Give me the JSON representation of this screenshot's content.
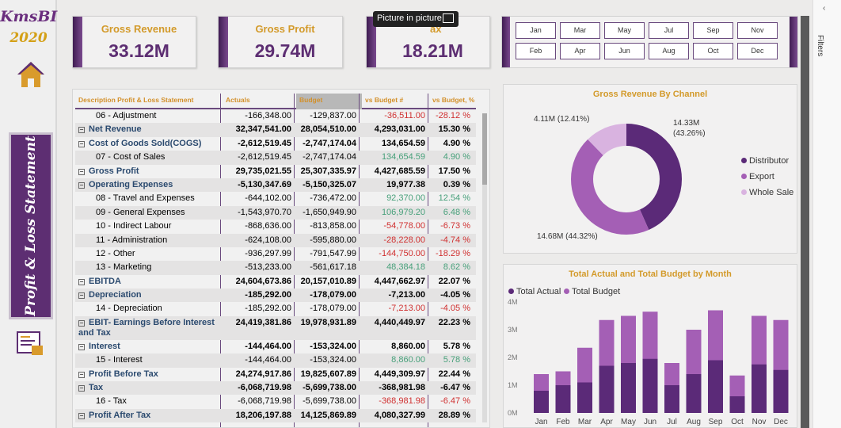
{
  "app": {
    "logo_title": "KmsBI",
    "logo_year": "2020",
    "side_title": "Profit & Loss Statement",
    "pip_label": "Picture in picture",
    "filters_label": "Filters"
  },
  "kpis": [
    {
      "label": "Gross Revenue",
      "value": "33.12M"
    },
    {
      "label": "Gross Profit",
      "value": "29.74M"
    },
    {
      "label": "ax",
      "value": "18.21M"
    }
  ],
  "months": [
    [
      "Jan",
      "Mar",
      "May",
      "Jul",
      "Sep",
      "Nov"
    ],
    [
      "Feb",
      "Apr",
      "Jun",
      "Aug",
      "Oct",
      "Dec"
    ]
  ],
  "table": {
    "headers": [
      "Description Profit & Loss Statement",
      "Actuals",
      "Budget",
      "vs Budget #",
      "vs Budget, %"
    ],
    "rows": [
      {
        "desc": "06 - Adjustment",
        "level": 1,
        "actual": "-166,348.00",
        "budget": "-129,837.00",
        "vb": "-36,511.00",
        "vp": "-28.12 %",
        "tone": "neg"
      },
      {
        "desc": "Net Revenue",
        "level": 0,
        "actual": "32,347,541.00",
        "budget": "28,054,510.00",
        "vb": "4,293,031.00",
        "vp": "15.30 %",
        "tone": ""
      },
      {
        "desc": "Cost of Goods Sold(COGS)",
        "level": 0,
        "actual": "-2,612,519.45",
        "budget": "-2,747,174.04",
        "vb": "134,654.59",
        "vp": "4.90 %",
        "tone": ""
      },
      {
        "desc": "07 - Cost of Sales",
        "level": 1,
        "actual": "-2,612,519.45",
        "budget": "-2,747,174.04",
        "vb": "134,654.59",
        "vp": "4.90 %",
        "tone": "pos"
      },
      {
        "desc": "Gross Profit",
        "level": 0,
        "actual": "29,735,021.55",
        "budget": "25,307,335.97",
        "vb": "4,427,685.59",
        "vp": "17.50 %",
        "tone": ""
      },
      {
        "desc": "Operating Expenses",
        "level": 0,
        "actual": "-5,130,347.69",
        "budget": "-5,150,325.07",
        "vb": "19,977.38",
        "vp": "0.39 %",
        "tone": ""
      },
      {
        "desc": "08 - Travel and Expenses",
        "level": 1,
        "actual": "-644,102.00",
        "budget": "-736,472.00",
        "vb": "92,370.00",
        "vp": "12.54 %",
        "tone": "pos"
      },
      {
        "desc": "09 - General Expenses",
        "level": 1,
        "actual": "-1,543,970.70",
        "budget": "-1,650,949.90",
        "vb": "106,979.20",
        "vp": "6.48 %",
        "tone": "pos"
      },
      {
        "desc": "10 - Indirect Labour",
        "level": 1,
        "actual": "-868,636.00",
        "budget": "-813,858.00",
        "vb": "-54,778.00",
        "vp": "-6.73 %",
        "tone": "neg"
      },
      {
        "desc": "11 - Administration",
        "level": 1,
        "actual": "-624,108.00",
        "budget": "-595,880.00",
        "vb": "-28,228.00",
        "vp": "-4.74 %",
        "tone": "neg"
      },
      {
        "desc": "12 - Other",
        "level": 1,
        "actual": "-936,297.99",
        "budget": "-791,547.99",
        "vb": "-144,750.00",
        "vp": "-18.29 %",
        "tone": "neg"
      },
      {
        "desc": "13 - Marketing",
        "level": 1,
        "actual": "-513,233.00",
        "budget": "-561,617.18",
        "vb": "48,384.18",
        "vp": "8.62 %",
        "tone": "pos"
      },
      {
        "desc": "EBITDA",
        "level": 0,
        "actual": "24,604,673.86",
        "budget": "20,157,010.89",
        "vb": "4,447,662.97",
        "vp": "22.07 %",
        "tone": ""
      },
      {
        "desc": "Depreciation",
        "level": 0,
        "actual": "-185,292.00",
        "budget": "-178,079.00",
        "vb": "-7,213.00",
        "vp": "-4.05 %",
        "tone": ""
      },
      {
        "desc": "14 - Depreciation",
        "level": 1,
        "actual": "-185,292.00",
        "budget": "-178,079.00",
        "vb": "-7,213.00",
        "vp": "-4.05 %",
        "tone": "neg"
      },
      {
        "desc": "EBIT- Earnings Before Interest and Tax",
        "level": 0,
        "tall": true,
        "actual": "24,419,381.86",
        "budget": "19,978,931.89",
        "vb": "4,440,449.97",
        "vp": "22.23 %",
        "tone": ""
      },
      {
        "desc": "Interest",
        "level": 0,
        "actual": "-144,464.00",
        "budget": "-153,324.00",
        "vb": "8,860.00",
        "vp": "5.78 %",
        "tone": ""
      },
      {
        "desc": "15 - Interest",
        "level": 1,
        "actual": "-144,464.00",
        "budget": "-153,324.00",
        "vb": "8,860.00",
        "vp": "5.78 %",
        "tone": "pos"
      },
      {
        "desc": "Profit Before Tax",
        "level": 0,
        "actual": "24,274,917.86",
        "budget": "19,825,607.89",
        "vb": "4,449,309.97",
        "vp": "22.44 %",
        "tone": ""
      },
      {
        "desc": "Tax",
        "level": 0,
        "actual": "-6,068,719.98",
        "budget": "-5,699,738.00",
        "vb": "-368,981.98",
        "vp": "-6.47 %",
        "tone": ""
      },
      {
        "desc": "16 - Tax",
        "level": 1,
        "actual": "-6,068,719.98",
        "budget": "-5,699,738.00",
        "vb": "-368,981.98",
        "vp": "-6.47 %",
        "tone": "neg"
      },
      {
        "desc": "Profit After Tax",
        "level": 0,
        "actual": "18,206,197.88",
        "budget": "14,125,869.89",
        "vb": "4,080,327.99",
        "vp": "28.89 %",
        "tone": ""
      }
    ]
  },
  "donut": {
    "title": "Gross Revenue By Channel",
    "legend": [
      {
        "name": "Distributor",
        "color": "#5b2a78"
      },
      {
        "name": "Export",
        "color": "#a45fb5"
      },
      {
        "name": "Whole Sale",
        "color": "#d9b3e0"
      }
    ],
    "labels": [
      "14.33M",
      "(43.26%)",
      "14.68M (44.32%)",
      "4.11M (12.41%)"
    ]
  },
  "chart_data": {
    "type": "bar",
    "title": "Total Actual and Total Budget by Month",
    "categories": [
      "Jan",
      "Feb",
      "Mar",
      "Apr",
      "May",
      "Jun",
      "Jul",
      "Aug",
      "Sep",
      "Oct",
      "Nov",
      "Dec"
    ],
    "series": [
      {
        "name": "Total Actual",
        "color": "#5b2a78",
        "values": [
          0.8,
          1.0,
          1.1,
          1.7,
          1.8,
          1.95,
          1.0,
          1.4,
          1.9,
          0.6,
          1.75,
          1.55
        ]
      },
      {
        "name": "Total Budget",
        "color": "#a45fb5",
        "values": [
          1.4,
          1.5,
          2.35,
          3.35,
          3.5,
          3.65,
          1.8,
          3.0,
          3.7,
          1.35,
          3.5,
          3.35
        ]
      }
    ],
    "yticks": [
      "0M",
      "1M",
      "2M",
      "3M",
      "4M"
    ],
    "ylim": [
      0,
      4
    ]
  }
}
